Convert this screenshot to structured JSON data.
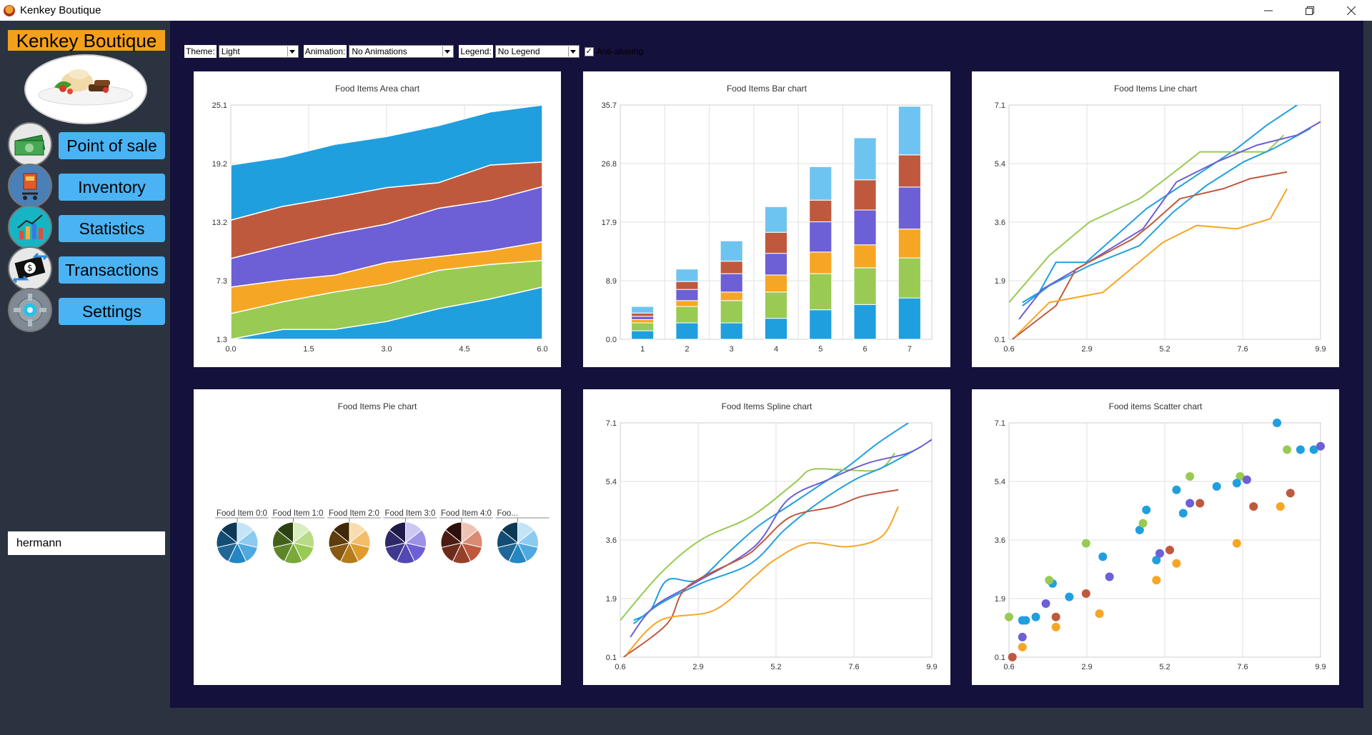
{
  "window": {
    "title": "Kenkey Boutique"
  },
  "sidebar": {
    "brand": "Kenkey Boutique",
    "items": [
      {
        "label": "Point of sale",
        "icon": "money-icon"
      },
      {
        "label": "Inventory",
        "icon": "cart-icon"
      },
      {
        "label": "Statistics",
        "icon": "bar-chart-icon"
      },
      {
        "label": "Transactions",
        "icon": "transfer-icon"
      },
      {
        "label": "Settings",
        "icon": "gear-icon"
      }
    ],
    "user": "hermann"
  },
  "toolbar": {
    "theme_label": "Theme:",
    "theme_value": "Light",
    "animation_label": "Animation:",
    "animation_value": "No Animations",
    "legend_label": "Legend:",
    "legend_value": "No Legend",
    "antialias_label": "Anti-aliasing",
    "antialias_checked": true
  },
  "colors": {
    "blue": "#209fdf",
    "green": "#99ca53",
    "orange": "#f6a625",
    "purple": "#6d5fd5",
    "red": "#bf593e",
    "lightblue": "#6ec4f0"
  },
  "chart_data": [
    {
      "id": "area",
      "type": "area",
      "title": "Food Items Area chart",
      "x_ticks": [
        "0.0",
        "1.5",
        "3.0",
        "4.5",
        "6.0"
      ],
      "y_ticks": [
        "1.3",
        "7.3",
        "13.2",
        "19.2",
        "25.1"
      ],
      "xlim": [
        0,
        6
      ],
      "ylim": [
        1.3,
        25.1
      ],
      "x": [
        0,
        1,
        2,
        3,
        4,
        5,
        6
      ],
      "series": [
        {
          "color": "#209fdf",
          "values": [
            1.3,
            2.3,
            2.3,
            3.1,
            4.4,
            5.4,
            6.6
          ]
        },
        {
          "color": "#99ca53",
          "values": [
            3.9,
            5.1,
            6.1,
            6.9,
            8.3,
            8.9,
            9.3
          ]
        },
        {
          "color": "#f6a625",
          "values": [
            6.6,
            7.3,
            7.8,
            9.1,
            9.7,
            10.3,
            11.2
          ]
        },
        {
          "color": "#6d5fd5",
          "values": [
            9.5,
            10.8,
            12.0,
            13.0,
            14.6,
            15.4,
            16.8
          ]
        },
        {
          "color": "#bf593e",
          "values": [
            13.4,
            14.8,
            15.7,
            16.7,
            17.2,
            19.0,
            19.3
          ]
        },
        {
          "color": "#209fdf",
          "values": [
            19.0,
            19.8,
            21.1,
            21.9,
            23.0,
            24.4,
            25.1
          ]
        }
      ]
    },
    {
      "id": "bar",
      "type": "bar",
      "title": "Food Items Bar chart",
      "categories": [
        "1",
        "2",
        "3",
        "4",
        "5",
        "6",
        "7"
      ],
      "y_ticks": [
        "0.0",
        "8.9",
        "17.9",
        "26.8",
        "35.7"
      ],
      "ylim": [
        0,
        35.7
      ],
      "series": [
        {
          "color": "#209fdf",
          "values": [
            1.3,
            2.5,
            2.5,
            3.2,
            4.5,
            5.3,
            6.3
          ]
        },
        {
          "color": "#99ca53",
          "values": [
            1.2,
            2.5,
            3.4,
            4.0,
            5.5,
            5.6,
            6.1
          ]
        },
        {
          "color": "#f6a625",
          "values": [
            0.5,
            0.9,
            1.3,
            2.6,
            3.3,
            3.5,
            4.4
          ]
        },
        {
          "color": "#6d5fd5",
          "values": [
            0.5,
            1.7,
            2.8,
            3.3,
            4.6,
            5.3,
            6.4
          ]
        },
        {
          "color": "#bf593e",
          "values": [
            0.5,
            1.2,
            1.9,
            3.2,
            3.3,
            4.6,
            4.9
          ]
        },
        {
          "color": "#6ec4f0",
          "values": [
            1.0,
            1.9,
            3.1,
            3.9,
            5.1,
            6.4,
            7.4
          ]
        }
      ]
    },
    {
      "id": "line",
      "type": "line",
      "title": "Food Items Line chart",
      "x_ticks": [
        "0.6",
        "2.9",
        "5.2",
        "7.6",
        "9.9"
      ],
      "y_ticks": [
        "0.1",
        "1.9",
        "3.6",
        "5.4",
        "7.1"
      ],
      "xlim": [
        0.6,
        9.9
      ],
      "ylim": [
        0.1,
        7.1
      ],
      "series": [
        {
          "color": "#209fdf",
          "x": [
            1.0,
            1.5,
            2.0,
            2.9,
            3.8,
            4.7,
            5.6,
            6.5,
            7.4,
            8.3,
            9.2
          ],
          "y": [
            1.2,
            1.5,
            2.4,
            2.4,
            3.2,
            4.0,
            4.6,
            5.2,
            5.8,
            6.5,
            7.1
          ]
        },
        {
          "color": "#99ca53",
          "x": [
            0.6,
            1.8,
            3.0,
            4.5,
            5.8,
            6.3,
            7.2,
            8.3,
            8.8
          ],
          "y": [
            1.2,
            2.6,
            3.6,
            4.3,
            5.3,
            5.7,
            5.7,
            5.7,
            6.2
          ]
        },
        {
          "color": "#209fdf",
          "x": [
            1.0,
            1.8,
            3.0,
            4.5,
            5.5,
            6.5,
            7.6,
            8.5,
            9.6
          ],
          "y": [
            1.1,
            1.7,
            2.3,
            2.9,
            3.9,
            4.7,
            5.4,
            5.8,
            6.4
          ]
        },
        {
          "color": "#6d5fd5",
          "x": [
            0.9,
            1.6,
            2.8,
            4.6,
            5.6,
            6.8,
            8.0,
            9.2,
            9.9
          ],
          "y": [
            0.7,
            1.6,
            2.3,
            3.4,
            4.8,
            5.4,
            5.9,
            6.2,
            6.6
          ]
        },
        {
          "color": "#bf593e",
          "x": [
            0.7,
            2.0,
            2.6,
            4.3,
            4.8,
            5.7,
            7.0,
            7.8,
            8.9
          ],
          "y": [
            0.1,
            1.1,
            2.2,
            3.1,
            3.5,
            4.3,
            4.6,
            4.9,
            5.1
          ]
        },
        {
          "color": "#f6a625",
          "x": [
            0.8,
            1.8,
            3.4,
            4.6,
            5.2,
            6.2,
            7.4,
            8.4,
            8.9
          ],
          "y": [
            0.2,
            1.2,
            1.5,
            2.5,
            3.0,
            3.5,
            3.4,
            3.7,
            4.6
          ]
        }
      ]
    },
    {
      "id": "pie",
      "type": "pie",
      "title": "Food Items Pie chart",
      "pies": [
        {
          "label": "Food Item 0:0",
          "colors": [
            "#0d3956",
            "#144d74",
            "#1e6796",
            "#2587c2",
            "#4fa9de",
            "#8ccaf0",
            "#c3e3f7"
          ]
        },
        {
          "label": "Food Item 1:0",
          "colors": [
            "#2c4113",
            "#43611d",
            "#5f8529",
            "#7aa83a",
            "#99ca53",
            "#b8db86",
            "#d9edbf"
          ]
        },
        {
          "label": "Food Item 2:0",
          "colors": [
            "#3e2807",
            "#5e3c0c",
            "#875912",
            "#b57c1b",
            "#e09c2a",
            "#f3bd6a",
            "#f8dcae"
          ]
        },
        {
          "label": "Food Item 3:0",
          "colors": [
            "#1e1a4a",
            "#2d2868",
            "#3f388e",
            "#5349b4",
            "#6d5fd5",
            "#9c92e6",
            "#cdc8f3"
          ]
        },
        {
          "label": "Food Item 4:0",
          "colors": [
            "#2e100a",
            "#4a1c12",
            "#6d2b1c",
            "#94402b",
            "#bf593e",
            "#d98c74",
            "#efc3b4"
          ]
        },
        {
          "label": "Foo...",
          "colors": [
            "#0d3956",
            "#144d74",
            "#1e6796",
            "#2587c2",
            "#4fa9de",
            "#8ccaf0",
            "#c3e3f7"
          ]
        }
      ]
    },
    {
      "id": "spline",
      "type": "line",
      "title": "Food Items Spline chart",
      "x_ticks": [
        "0.6",
        "2.9",
        "5.2",
        "7.6",
        "9.9"
      ],
      "y_ticks": [
        "0.1",
        "1.9",
        "3.6",
        "5.4",
        "7.1"
      ],
      "xlim": [
        0.6,
        9.9
      ],
      "ylim": [
        0.1,
        7.1
      ],
      "series": [
        {
          "color": "#209fdf",
          "x": [
            1.0,
            1.5,
            2.0,
            2.9,
            3.8,
            4.7,
            5.6,
            6.5,
            7.4,
            8.3,
            9.2
          ],
          "y": [
            1.2,
            1.5,
            2.4,
            2.4,
            3.2,
            4.0,
            4.6,
            5.2,
            5.8,
            6.5,
            7.1
          ]
        },
        {
          "color": "#99ca53",
          "x": [
            0.6,
            1.8,
            3.0,
            4.5,
            5.8,
            6.3,
            7.2,
            8.3,
            8.8
          ],
          "y": [
            1.2,
            2.6,
            3.6,
            4.3,
            5.3,
            5.7,
            5.7,
            5.7,
            6.2
          ]
        },
        {
          "color": "#209fdf",
          "x": [
            1.0,
            1.8,
            3.0,
            4.5,
            5.5,
            6.5,
            7.6,
            8.5,
            9.6
          ],
          "y": [
            1.1,
            1.7,
            2.3,
            2.9,
            3.9,
            4.7,
            5.4,
            5.8,
            6.4
          ]
        },
        {
          "color": "#6d5fd5",
          "x": [
            0.9,
            1.6,
            2.8,
            4.6,
            5.6,
            6.8,
            8.0,
            9.2,
            9.9
          ],
          "y": [
            0.7,
            1.6,
            2.3,
            3.4,
            4.8,
            5.4,
            5.9,
            6.2,
            6.6
          ]
        },
        {
          "color": "#bf593e",
          "x": [
            0.7,
            2.0,
            2.6,
            4.3,
            4.8,
            5.7,
            7.0,
            7.8,
            8.9
          ],
          "y": [
            0.1,
            1.1,
            2.2,
            3.1,
            3.5,
            4.3,
            4.6,
            4.9,
            5.1
          ]
        },
        {
          "color": "#f6a625",
          "x": [
            0.8,
            1.8,
            3.4,
            4.6,
            5.2,
            6.2,
            7.4,
            8.4,
            8.9
          ],
          "y": [
            0.2,
            1.2,
            1.5,
            2.5,
            3.0,
            3.5,
            3.4,
            3.7,
            4.6
          ]
        }
      ]
    },
    {
      "id": "scatter",
      "type": "scatter",
      "title": "Food items Scatter chart",
      "x_ticks": [
        "0.6",
        "2.9",
        "5.2",
        "7.6",
        "9.9"
      ],
      "y_ticks": [
        "0.1",
        "1.9",
        "3.6",
        "5.4",
        "7.1"
      ],
      "xlim": [
        0.6,
        9.9
      ],
      "ylim": [
        0.1,
        7.1
      ],
      "series": [
        {
          "color": "#209fdf",
          "x": [
            1.0,
            1.4,
            1.9,
            2.4,
            3.4,
            4.5,
            5.0,
            5.6,
            6.8,
            8.6,
            9.7
          ],
          "y": [
            1.2,
            1.3,
            2.3,
            1.9,
            3.1,
            3.9,
            3.0,
            5.1,
            5.2,
            7.1,
            6.3
          ]
        },
        {
          "color": "#99ca53",
          "x": [
            0.6,
            1.8,
            2.9,
            4.6,
            6.0,
            7.5,
            8.9
          ],
          "y": [
            1.3,
            2.4,
            3.5,
            4.1,
            5.5,
            5.5,
            6.3
          ]
        },
        {
          "color": "#f6a625",
          "x": [
            1.0,
            2.0,
            3.3,
            5.0,
            5.6,
            7.4,
            8.7
          ],
          "y": [
            0.4,
            1.0,
            1.4,
            2.4,
            2.9,
            3.5,
            4.6
          ]
        },
        {
          "color": "#6d5fd5",
          "x": [
            1.0,
            1.7,
            3.6,
            5.1,
            6.0,
            7.7,
            9.9
          ],
          "y": [
            0.7,
            1.7,
            2.5,
            3.2,
            4.7,
            5.4,
            6.4
          ]
        },
        {
          "color": "#bf593e",
          "x": [
            0.7,
            2.0,
            2.9,
            5.4,
            6.3,
            7.9,
            9.0
          ],
          "y": [
            0.1,
            1.3,
            2.0,
            3.3,
            4.7,
            4.6,
            5.0
          ]
        },
        {
          "color": "#209fdf",
          "x": [
            4.7,
            5.8,
            7.4,
            9.3,
            1.1
          ],
          "y": [
            4.5,
            4.4,
            5.3,
            6.3,
            1.2
          ]
        }
      ]
    }
  ]
}
